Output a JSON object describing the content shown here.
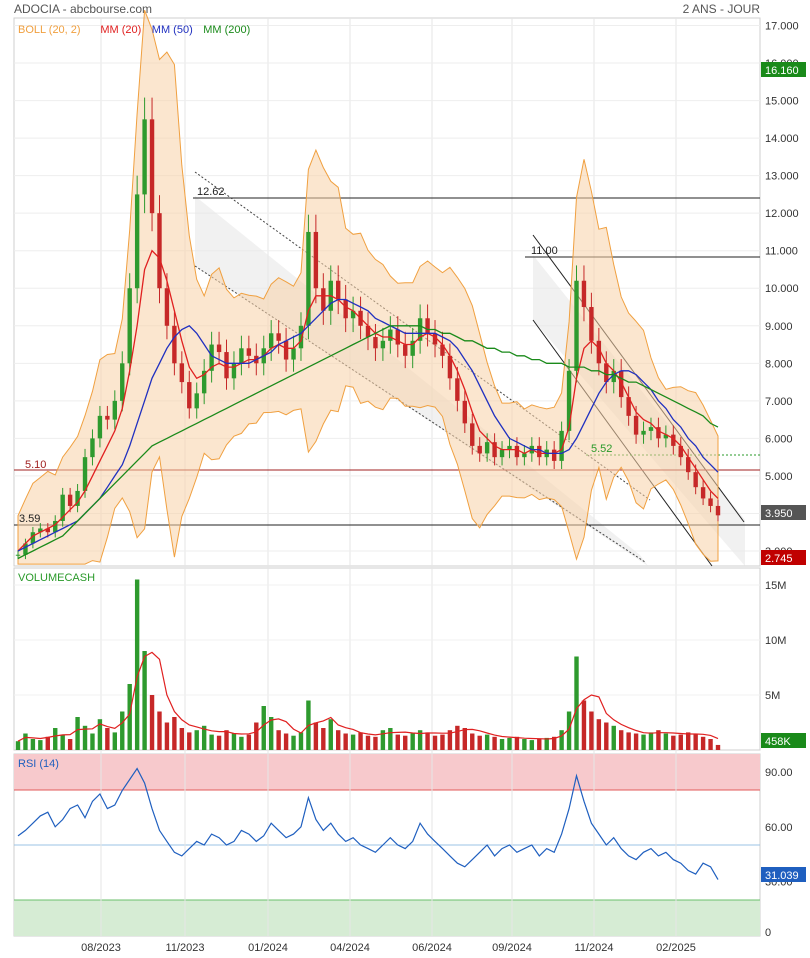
{
  "header": {
    "symbol_source": "ADOCIA - abcbourse.com",
    "period": "2 ANS - JOUR"
  },
  "legend": [
    {
      "label": "BOLL (20, 2)",
      "color": "#f0a040"
    },
    {
      "label": "MM (20)",
      "color": "#e02020"
    },
    {
      "label": "MM (50)",
      "color": "#2030c0"
    },
    {
      "label": "MM (200)",
      "color": "#1a8a1a"
    }
  ],
  "panels": {
    "volume_title": "VOLUMECASH",
    "rsi_title": "RSI (14)"
  },
  "badges": {
    "high": "16.160",
    "last": "3.950",
    "low": "2.745",
    "volume": "458K",
    "rsi": "31.039"
  },
  "annotations": {
    "peak1": "12.62",
    "peak2": "11.00",
    "support": "5.10",
    "low_level": "3.59",
    "mid_level": "5.52"
  },
  "chart_data": [
    {
      "type": "line",
      "panel": "price",
      "title": "ADOCIA",
      "y_ticks": [
        "17.000",
        "16.000",
        "15.000",
        "14.000",
        "13.000",
        "12.000",
        "11.000",
        "10.000",
        "9.000",
        "8.000",
        "7.000",
        "6.000",
        "5.000",
        "4.000",
        "3.000"
      ],
      "ylim": [
        2.6,
        17.2
      ],
      "x_ticks": [
        "08/2023",
        "11/2023",
        "01/2024",
        "04/2024",
        "06/2024",
        "09/2024",
        "11/2024",
        "02/2025"
      ],
      "series": [
        {
          "name": "Close",
          "color": "#2e7d32",
          "values": [
            2.9,
            3.2,
            3.5,
            3.6,
            3.5,
            3.8,
            4.5,
            4.2,
            4.6,
            5.5,
            6.0,
            6.6,
            6.5,
            7.0,
            8.0,
            10.0,
            12.5,
            14.5,
            12.0,
            10.0,
            9.0,
            8.0,
            7.5,
            6.8,
            7.2,
            7.8,
            8.5,
            8.3,
            7.6,
            8.0,
            8.4,
            8.2,
            8.0,
            8.4,
            8.8,
            8.6,
            8.1,
            8.4,
            9.0,
            11.5,
            10.0,
            9.4,
            10.2,
            9.7,
            9.2,
            9.4,
            9.0,
            8.7,
            8.4,
            8.6,
            8.9,
            8.5,
            8.2,
            8.6,
            9.2,
            8.8,
            8.5,
            8.2,
            7.6,
            7.0,
            6.4,
            5.8,
            5.6,
            5.9,
            5.5,
            5.7,
            5.8,
            5.5,
            5.6,
            5.8,
            5.5,
            5.7,
            5.4,
            6.2,
            7.8,
            10.2,
            9.5,
            8.6,
            8.0,
            7.5,
            7.8,
            7.1,
            6.6,
            6.1,
            6.2,
            6.3,
            6.0,
            6.1,
            5.8,
            5.5,
            5.1,
            4.7,
            4.4,
            4.2,
            3.95
          ]
        },
        {
          "name": "MM (20)",
          "color": "#e02020",
          "values": [
            3.0,
            3.2,
            3.4,
            3.5,
            3.6,
            3.7,
            3.9,
            4.1,
            4.3,
            4.6,
            5.0,
            5.4,
            5.8,
            6.2,
            6.8,
            7.8,
            9.0,
            10.5,
            11.0,
            10.8,
            10.2,
            9.4,
            8.6,
            7.9,
            7.6,
            7.7,
            7.9,
            8.0,
            7.9,
            7.9,
            8.0,
            8.1,
            8.1,
            8.2,
            8.4,
            8.5,
            8.4,
            8.4,
            8.6,
            9.4,
            9.8,
            9.8,
            9.8,
            9.7,
            9.5,
            9.4,
            9.2,
            9.0,
            8.8,
            8.7,
            8.7,
            8.6,
            8.5,
            8.5,
            8.7,
            8.8,
            8.7,
            8.5,
            8.2,
            7.8,
            7.3,
            6.7,
            6.2,
            6.0,
            5.8,
            5.7,
            5.7,
            5.7,
            5.6,
            5.7,
            5.6,
            5.6,
            5.6,
            5.7,
            6.3,
            7.6,
            8.4,
            8.6,
            8.4,
            8.0,
            7.8,
            7.5,
            7.1,
            6.7,
            6.5,
            6.4,
            6.2,
            6.1,
            6.0,
            5.8,
            5.5,
            5.2,
            4.9,
            4.6,
            4.4
          ]
        },
        {
          "name": "MM (50)",
          "color": "#2030c0",
          "values": [
            3.0,
            3.1,
            3.2,
            3.3,
            3.4,
            3.5,
            3.6,
            3.7,
            3.8,
            4.0,
            4.2,
            4.4,
            4.7,
            5.0,
            5.3,
            5.8,
            6.4,
            7.0,
            7.6,
            8.0,
            8.4,
            8.7,
            8.9,
            9.0,
            8.8,
            8.5,
            8.2,
            8.1,
            8.0,
            8.0,
            8.0,
            8.0,
            8.1,
            8.2,
            8.3,
            8.5,
            8.6,
            8.7,
            8.8,
            9.0,
            9.2,
            9.4,
            9.6,
            9.7,
            9.7,
            9.6,
            9.5,
            9.4,
            9.2,
            9.1,
            9.0,
            8.9,
            8.8,
            8.8,
            8.8,
            8.8,
            8.8,
            8.7,
            8.6,
            8.4,
            8.1,
            7.8,
            7.4,
            7.0,
            6.6,
            6.3,
            6.0,
            5.9,
            5.8,
            5.7,
            5.7,
            5.6,
            5.6,
            5.6,
            5.7,
            6.0,
            6.4,
            6.8,
            7.2,
            7.5,
            7.7,
            7.8,
            7.8,
            7.7,
            7.5,
            7.3,
            7.0,
            6.8,
            6.5,
            6.3,
            6.0,
            5.8,
            5.5,
            5.3,
            5.1
          ]
        },
        {
          "name": "MM (200)",
          "color": "#1a8a1a",
          "values": [
            2.8,
            2.9,
            3.0,
            3.1,
            3.2,
            3.3,
            3.4,
            3.6,
            3.8,
            4.0,
            4.2,
            4.4,
            4.6,
            4.8,
            5.0,
            5.2,
            5.4,
            5.6,
            5.8,
            5.9,
            6.0,
            6.1,
            6.2,
            6.3,
            6.4,
            6.5,
            6.6,
            6.7,
            6.8,
            6.9,
            7.0,
            7.1,
            7.2,
            7.3,
            7.4,
            7.5,
            7.6,
            7.7,
            7.8,
            7.9,
            8.0,
            8.1,
            8.2,
            8.3,
            8.4,
            8.5,
            8.6,
            8.7,
            8.8,
            8.9,
            9.0,
            9.0,
            9.0,
            9.0,
            9.0,
            8.9,
            8.9,
            8.8,
            8.8,
            8.7,
            8.6,
            8.6,
            8.5,
            8.4,
            8.4,
            8.3,
            8.3,
            8.2,
            8.2,
            8.1,
            8.1,
            8.0,
            8.0,
            8.0,
            7.9,
            7.9,
            7.9,
            7.8,
            7.8,
            7.7,
            7.7,
            7.6,
            7.5,
            7.5,
            7.4,
            7.3,
            7.2,
            7.1,
            7.0,
            6.9,
            6.8,
            6.7,
            6.6,
            6.4,
            6.3
          ]
        }
      ]
    },
    {
      "type": "bar",
      "panel": "volume",
      "title": "VOLUMECASH",
      "y_ticks": [
        "15M",
        "10M",
        "5M"
      ],
      "ylim": [
        0,
        16
      ],
      "values": [
        0.8,
        1.5,
        1.0,
        0.9,
        1.2,
        2.0,
        1.4,
        1.0,
        3.0,
        2.2,
        1.5,
        2.8,
        2.0,
        1.6,
        3.5,
        6.0,
        15.5,
        9.0,
        5.0,
        3.5,
        2.5,
        3.0,
        2.0,
        1.6,
        1.8,
        2.2,
        1.4,
        1.3,
        1.8,
        1.5,
        1.2,
        1.4,
        2.5,
        4.0,
        3.0,
        1.8,
        1.5,
        1.3,
        1.6,
        4.5,
        2.5,
        2.0,
        2.8,
        1.8,
        1.5,
        1.4,
        1.6,
        1.3,
        1.2,
        1.8,
        2.0,
        1.4,
        1.3,
        1.5,
        1.8,
        1.6,
        1.3,
        1.4,
        1.8,
        2.2,
        2.0,
        1.5,
        1.3,
        1.4,
        1.2,
        1.0,
        1.1,
        1.2,
        1.0,
        0.9,
        1.0,
        1.1,
        1.2,
        1.8,
        3.5,
        8.5,
        4.5,
        3.5,
        2.8,
        2.5,
        2.2,
        1.8,
        1.6,
        1.5,
        1.4,
        1.6,
        1.8,
        1.5,
        1.3,
        1.4,
        1.6,
        1.5,
        1.2,
        1.0,
        0.46
      ]
    },
    {
      "type": "line",
      "panel": "rsi",
      "title": "RSI (14)",
      "y_ticks": [
        "90.00",
        "60.00",
        "30.00",
        "0"
      ],
      "ylim": [
        0,
        100
      ],
      "series": [
        {
          "name": "RSI (14)",
          "color": "#1f5fbf",
          "values": [
            55,
            58,
            62,
            66,
            68,
            60,
            64,
            70,
            72,
            65,
            74,
            78,
            70,
            72,
            80,
            86,
            92,
            84,
            70,
            58,
            52,
            46,
            44,
            48,
            52,
            50,
            56,
            54,
            50,
            52,
            58,
            56,
            52,
            55,
            62,
            58,
            54,
            56,
            60,
            76,
            64,
            58,
            62,
            56,
            52,
            54,
            50,
            48,
            46,
            50,
            54,
            50,
            48,
            52,
            62,
            56,
            52,
            48,
            44,
            40,
            38,
            42,
            46,
            50,
            44,
            48,
            50,
            46,
            48,
            50,
            44,
            48,
            46,
            56,
            70,
            88,
            74,
            62,
            56,
            50,
            54,
            48,
            44,
            42,
            46,
            48,
            44,
            46,
            42,
            40,
            36,
            34,
            40,
            38,
            31
          ]
        }
      ]
    }
  ]
}
